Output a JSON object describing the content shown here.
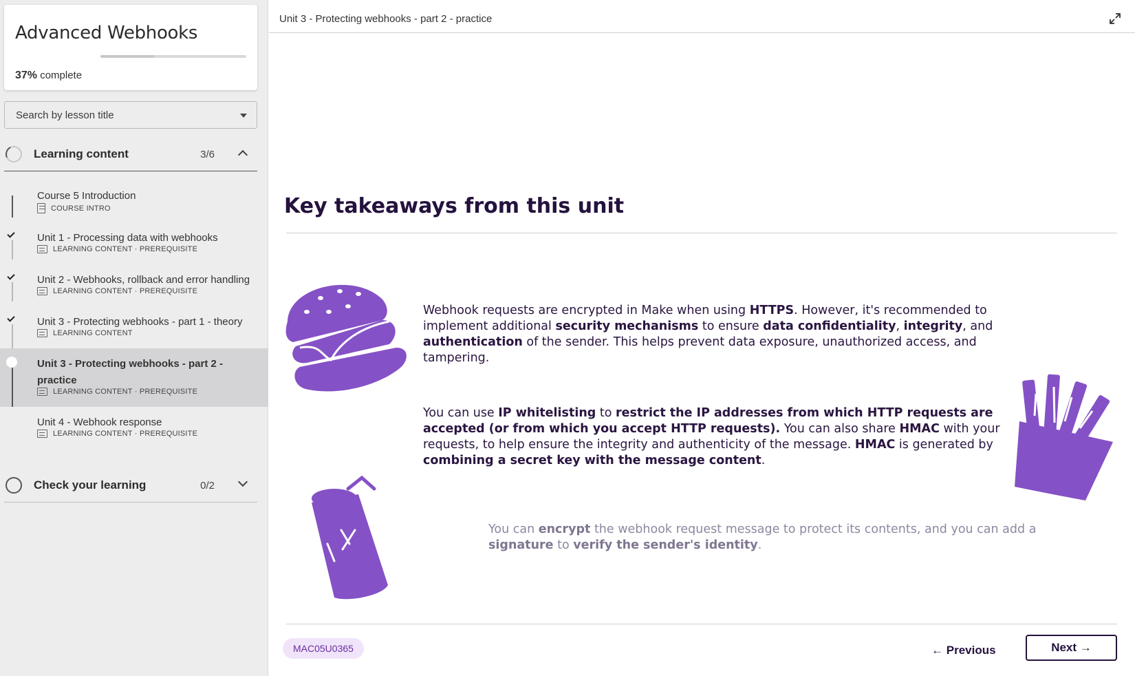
{
  "course": {
    "title": "Advanced Webhooks",
    "progress_percent": "37%",
    "progress_fraction": 0.37,
    "progress_suffix": "complete"
  },
  "search": {
    "placeholder": "Search by lesson title"
  },
  "sections": [
    {
      "title": "Learning content",
      "count": "3/6",
      "expanded": true
    },
    {
      "title": "Check your learning",
      "count": "0/2",
      "expanded": false
    }
  ],
  "lessons": [
    {
      "title": "Course 5 Introduction",
      "meta": "COURSE INTRO",
      "icon": "document-icon",
      "done": false
    },
    {
      "title": "Unit 1 - Processing data with webhooks",
      "meta": "LEARNING CONTENT · PREREQUISITE",
      "icon": "slides-icon",
      "done": true
    },
    {
      "title": "Unit 2 - Webhooks, rollback and error handling",
      "meta": "LEARNING CONTENT · PREREQUISITE",
      "icon": "slides-icon",
      "done": true
    },
    {
      "title": "Unit 3 - Protecting webhooks - part 1 - theory",
      "meta": "LEARNING CONTENT",
      "icon": "slides-icon",
      "done": true
    },
    {
      "title": "Unit 3 - Protecting webhooks - part 2 - practice",
      "meta": "LEARNING CONTENT · PREREQUISITE",
      "icon": "slides-icon",
      "done": false,
      "active": true
    },
    {
      "title": "Unit 4 - Webhook response",
      "meta": "LEARNING CONTENT · PREREQUISITE",
      "icon": "slides-icon",
      "done": false
    }
  ],
  "header": {
    "breadcrumb": "Unit 3 - Protecting webhooks - part 2 - practice",
    "expand_icon": "expand-icon"
  },
  "content": {
    "title": "Key takeaways from this unit",
    "p1": [
      {
        "t": "Webhook requests are encrypted in Make when using "
      },
      {
        "t": "HTTPS",
        "b": true
      },
      {
        "t": ". However, it's recommended to implement additional "
      },
      {
        "t": "security mechanisms",
        "b": true
      },
      {
        "t": " to ensure "
      },
      {
        "t": "data confidentiality",
        "b": true
      },
      {
        "t": ", "
      },
      {
        "t": "integrity",
        "b": true
      },
      {
        "t": ", and "
      },
      {
        "t": "authentication",
        "b": true
      },
      {
        "t": " of the sender. This helps prevent data exposure, unauthorized access, and tampering."
      }
    ],
    "p2": [
      {
        "t": "You can use "
      },
      {
        "t": "IP whitelisting",
        "b": true
      },
      {
        "t": " to "
      },
      {
        "t": "restrict the IP addresses from which HTTP requests are accepted (or from which you accept HTTP requests).",
        "b": true
      },
      {
        "t": " You can also share "
      },
      {
        "t": "HMAC",
        "b": true
      },
      {
        "t": " with your requests, to help ensure the integrity and authenticity of the message. "
      },
      {
        "t": "HMAC",
        "b": true
      },
      {
        "t": " is generated by "
      },
      {
        "t": "combining a secret key with the message content",
        "b": true
      },
      {
        "t": "."
      }
    ],
    "p3": [
      {
        "t": "You can "
      },
      {
        "t": "encrypt",
        "b": true
      },
      {
        "t": " the webhook request message to protect its contents, and you can add a "
      },
      {
        "t": "signature",
        "b": true
      },
      {
        "t": " to "
      },
      {
        "t": "verify the sender's identity",
        "b": true
      },
      {
        "t": "."
      }
    ]
  },
  "footer": {
    "code": "MAC05U0365",
    "previous_label": "Previous",
    "next_label": "Next"
  },
  "colors": {
    "accent": "#8551c6",
    "text_dark": "#24123d",
    "badge_bg": "#f0e4fb"
  }
}
